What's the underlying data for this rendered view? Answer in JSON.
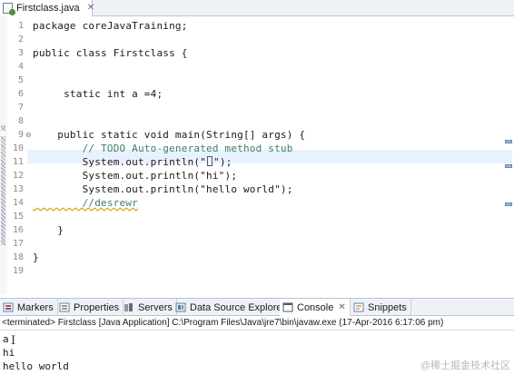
{
  "editor": {
    "tab": {
      "label": "Firstclass.java"
    },
    "lines": [
      {
        "n": "1",
        "text": "package coreJavaTraining;"
      },
      {
        "n": "2",
        "text": ""
      },
      {
        "n": "3",
        "text": "public class Firstclass {"
      },
      {
        "n": "4",
        "text": ""
      },
      {
        "n": "5",
        "text": ""
      },
      {
        "n": "6",
        "text": "     static int a =4;"
      },
      {
        "n": "7",
        "text": ""
      },
      {
        "n": "8",
        "text": ""
      },
      {
        "n": "9",
        "text": "    public static void main(String[] args) {"
      },
      {
        "n": "10",
        "text": "        // TODO Auto-generated method stub"
      },
      {
        "n": "11",
        "pre": "        System.out.println(\"",
        "post": "\");"
      },
      {
        "n": "12",
        "text": "        System.out.println(\"hi\");"
      },
      {
        "n": "13",
        "text": "        System.out.println(\"hello world\");"
      },
      {
        "n": "14",
        "text": "        //desrewr"
      },
      {
        "n": "15",
        "text": ""
      },
      {
        "n": "16",
        "text": "    }"
      },
      {
        "n": "17",
        "text": ""
      },
      {
        "n": "18",
        "text": "}"
      },
      {
        "n": "19",
        "text": ""
      }
    ]
  },
  "views": {
    "tabs": [
      {
        "label": "Markers",
        "icon": "markers-icon"
      },
      {
        "label": "Properties",
        "icon": "properties-icon"
      },
      {
        "label": "Servers",
        "icon": "servers-icon"
      },
      {
        "label": "Data Source Explorer",
        "icon": "data-source-icon"
      },
      {
        "label": "Console",
        "icon": "console-icon",
        "active": true
      },
      {
        "label": "Snippets",
        "icon": "snippets-icon"
      }
    ]
  },
  "console": {
    "status": "<terminated> Firstclass [Java Application] C:\\Program Files\\Java\\jre7\\bin\\javaw.exe (17-Apr-2016 6:17:06 pm)",
    "output": [
      "a",
      "hi",
      "hello world"
    ]
  },
  "watermark": "@稀土掘金技术社区"
}
